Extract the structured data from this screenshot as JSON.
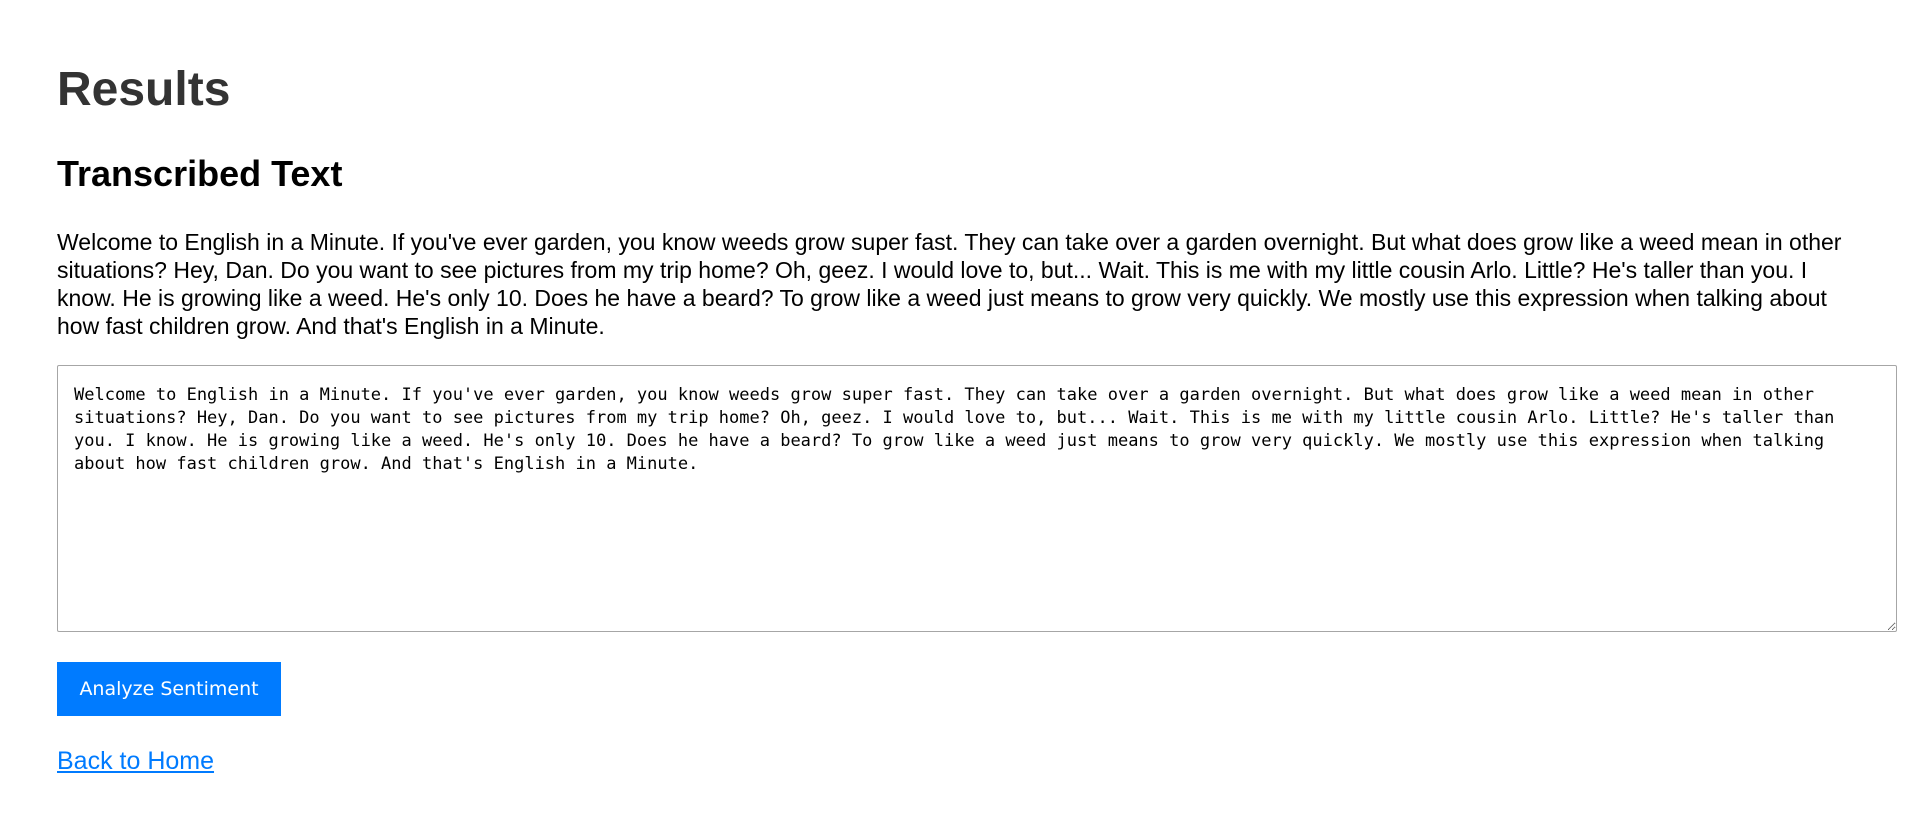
{
  "page": {
    "title": "Results"
  },
  "section": {
    "title": "Transcribed Text"
  },
  "transcript": {
    "paragraph": "Welcome to English in a Minute. If you've ever garden, you know weeds grow super fast. They can take over a garden overnight. But what does grow like a weed mean in other situations? Hey, Dan. Do you want to see pictures from my trip home? Oh, geez. I would love to, but... Wait. This is me with my little cousin Arlo. Little? He's taller than you. I know. He is growing like a weed. He's only 10. Does he have a beard? To grow like a weed just means to grow very quickly. We mostly use this expression when talking about how fast children grow. And that's English in a Minute.",
    "textarea_value": "Welcome to English in a Minute. If you've ever garden, you know weeds grow super fast. They can take over a garden overnight. But what does grow like a weed mean in other situations? Hey, Dan. Do you want to see pictures from my trip home? Oh, geez. I would love to, but... Wait. This is me with my little cousin Arlo. Little? He's taller than you. I know. He is growing like a weed. He's only 10. Does he have a beard? To grow like a weed just means to grow very quickly. We mostly use this expression when talking about how fast children grow. And that's English in a Minute."
  },
  "actions": {
    "analyze_label": "Analyze Sentiment",
    "back_label": "Back to Home"
  },
  "colors": {
    "accent": "#007bff",
    "title_text": "#333333",
    "body_text": "#000000",
    "textarea_border": "#a6a6a6"
  },
  "icons": {
    "textarea_resize": "resize-grip-icon"
  }
}
